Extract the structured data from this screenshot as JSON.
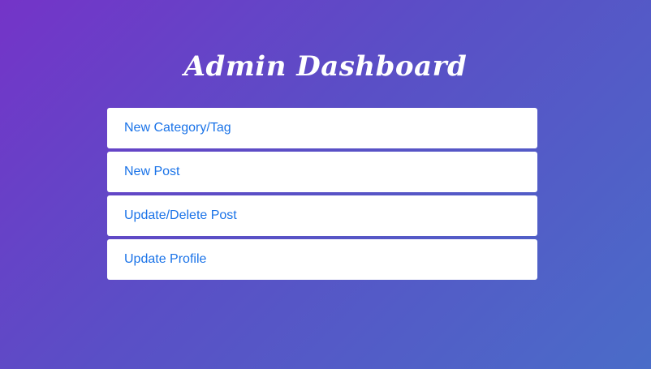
{
  "page": {
    "title": "Admin Dashboard"
  },
  "menu": {
    "items": [
      {
        "label": "New Category/Tag"
      },
      {
        "label": "New Post"
      },
      {
        "label": "Update/Delete Post"
      },
      {
        "label": "Update Profile"
      }
    ]
  },
  "colors": {
    "gradient_start": "#7434c8",
    "gradient_end": "#4a6cc8",
    "link": "#1a73e8",
    "card": "#ffffff",
    "title": "#ffffff"
  }
}
